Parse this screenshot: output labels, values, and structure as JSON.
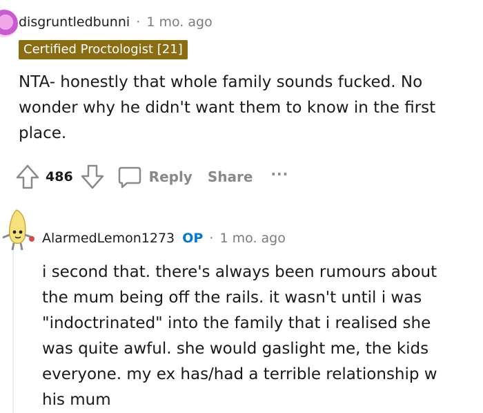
{
  "comments": [
    {
      "username": "disgruntledbunni",
      "separator": "·",
      "timestamp": "1 mo. ago",
      "flair": "Certified Proctologist [21]",
      "body_lines": [
        "NTA- honestly that whole family sounds fucked. No",
        "wonder why he didn't want them to know in the first",
        "place."
      ],
      "score": "486",
      "reply_label": "Reply",
      "share_label": "Share",
      "more_label": "···"
    },
    {
      "username": "AlarmedLemon1273",
      "op_badge": "OP",
      "separator": "·",
      "timestamp": "1 mo. ago",
      "body_lines": [
        "i second that. there's always been rumours about",
        "the mum being off the rails. it wasn't until i was",
        "\"indoctrinated\" into the family that i realised she",
        "was quite awful. she would gaslight me, the kids",
        "everyone. my ex has/had a terrible relationship w",
        "his mum"
      ]
    }
  ],
  "icons": {
    "upvote": "upvote-arrow-icon",
    "downvote": "downvote-arrow-icon",
    "reply": "speech-bubble-icon",
    "more": "ellipsis-icon"
  },
  "colors": {
    "flair_bg": "#8a6d12",
    "op_badge": "#0079d3",
    "muted": "#7c7c7c"
  }
}
